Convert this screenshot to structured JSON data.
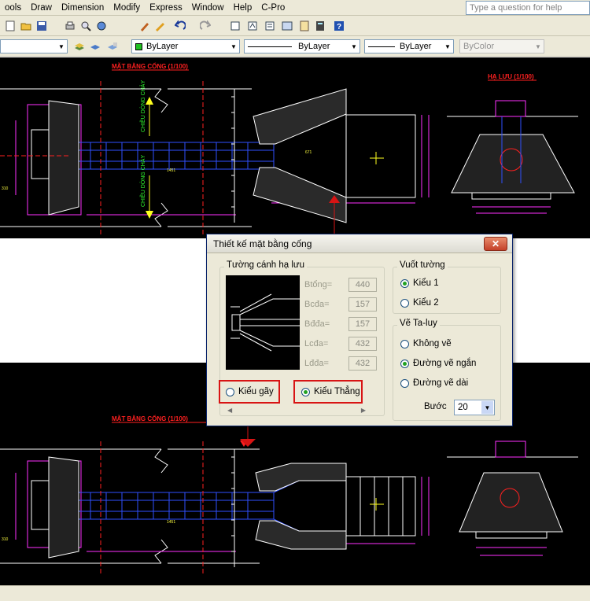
{
  "menu": [
    "ools",
    "Draw",
    "Dimension",
    "Modify",
    "Express",
    "Window",
    "Help",
    "C-Pro"
  ],
  "help_placeholder": "Type a question for help",
  "toolbar2": {
    "color": "ByLayer",
    "linetype": "ByLayer",
    "lineweight": "ByLayer",
    "plotstyle": "ByColor"
  },
  "drawing": {
    "plan_title": "MẶT BẰNG CỐNG (1/100)",
    "section_title": "HẠ LƯU (1/100)",
    "flow_label": "CHIỀU DÒNG CHẢY",
    "dims": [
      "671",
      "1451",
      "450",
      "350",
      "300",
      "60",
      "310"
    ]
  },
  "dialog": {
    "title": "Thiết kế mặt bằng cống",
    "group_wall": "Tường cánh hạ lưu",
    "fields": [
      {
        "label": "Btổng=",
        "value": "440"
      },
      {
        "label": "Bcđa=",
        "value": "157"
      },
      {
        "label": "Bđđa=",
        "value": "157"
      },
      {
        "label": "Lcđa=",
        "value": "432"
      },
      {
        "label": "Lđđa=",
        "value": "432"
      }
    ],
    "wall_type_gay": "Kiểu gãy",
    "wall_type_thang": "Kiểu Thẳng",
    "group_vuot": "Vuốt tường",
    "vuot_kieu1": "Kiểu 1",
    "vuot_kieu2": "Kiểu 2",
    "group_taluy": "Vẽ Ta-luy",
    "taluy_khong": "Không vẽ",
    "taluy_ngan": "Đường vẽ ngắn",
    "taluy_dai": "Đường vẽ dài",
    "buoc_label": "Bước",
    "buoc_value": "20"
  },
  "colors": {
    "accent_red": "#d81414",
    "title_bar": "#ece9d8",
    "cad_bg": "#000000"
  }
}
